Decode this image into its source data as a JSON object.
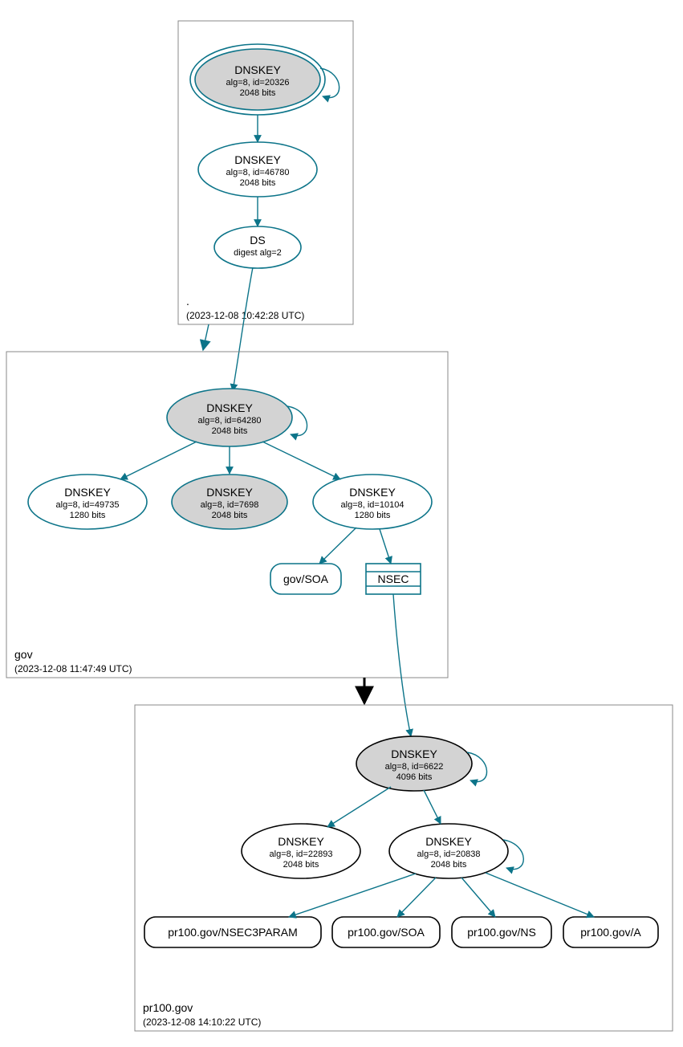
{
  "zones": {
    "root": {
      "name": ".",
      "timestamp": "(2023-12-08 10:42:28 UTC)"
    },
    "gov": {
      "name": "gov",
      "timestamp": "(2023-12-08 11:47:49 UTC)"
    },
    "pr": {
      "name": "pr100.gov",
      "timestamp": "(2023-12-08 14:10:22 UTC)"
    }
  },
  "nodes": {
    "rootKSK": {
      "title": "DNSKEY",
      "l1": "alg=8, id=20326",
      "l2": "2048 bits"
    },
    "rootZSK": {
      "title": "DNSKEY",
      "l1": "alg=8, id=46780",
      "l2": "2048 bits"
    },
    "rootDS": {
      "title": "DS",
      "l1": "digest alg=2"
    },
    "govKSK": {
      "title": "DNSKEY",
      "l1": "alg=8, id=64280",
      "l2": "2048 bits"
    },
    "govK1": {
      "title": "DNSKEY",
      "l1": "alg=8, id=49735",
      "l2": "1280 bits"
    },
    "govK2": {
      "title": "DNSKEY",
      "l1": "alg=8, id=7698",
      "l2": "2048 bits"
    },
    "govK3": {
      "title": "DNSKEY",
      "l1": "alg=8, id=10104",
      "l2": "1280 bits"
    },
    "prKSK": {
      "title": "DNSKEY",
      "l1": "alg=8, id=6622",
      "l2": "4096 bits"
    },
    "prK1": {
      "title": "DNSKEY",
      "l1": "alg=8, id=22893",
      "l2": "2048 bits"
    },
    "prK2": {
      "title": "DNSKEY",
      "l1": "alg=8, id=20838",
      "l2": "2048 bits"
    }
  },
  "rrsets": {
    "govSOA": "gov/SOA",
    "govNSEC": "NSEC",
    "prNSEC3": "pr100.gov/NSEC3PARAM",
    "prSOA": "pr100.gov/SOA",
    "prNS": "pr100.gov/NS",
    "prA": "pr100.gov/A"
  }
}
